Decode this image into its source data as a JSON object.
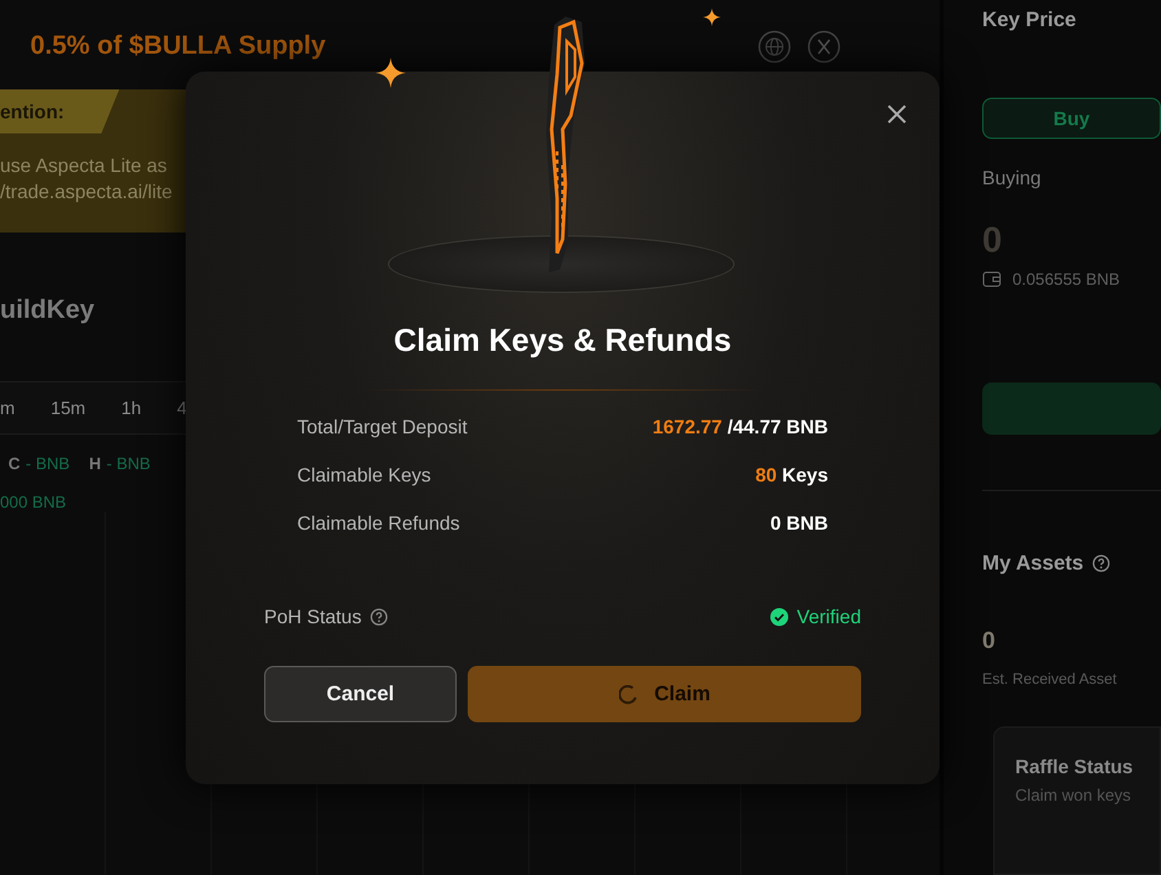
{
  "page": {
    "supply": "0.5% of $BULLA Supply",
    "attention": {
      "label": "ention:",
      "lines": [
        "use Aspecta Lite as",
        "/trade.aspecta.ai/lite"
      ]
    },
    "heading": "uildKey",
    "timeframes": [
      {
        "label": "m"
      },
      {
        "label": "15m"
      },
      {
        "label": "1h"
      },
      {
        "label": "4"
      }
    ],
    "ohlc": [
      {
        "key": "C",
        "value": "- BNB"
      },
      {
        "key": "H",
        "value": "- BNB"
      }
    ],
    "volume": "000 BNB"
  },
  "side_panel": {
    "title": "Key Price",
    "buy_button": "Buy",
    "buying_label": "Buying",
    "amount": "0",
    "balance": "0.056555 BNB",
    "assets_title": "My Assets",
    "assets_value": "0",
    "assets_caption": "Est. Received Asset",
    "raffle": {
      "title": "Raffle Status",
      "caption": "Claim won keys"
    }
  },
  "modal": {
    "title": "Claim Keys & Refunds",
    "rows": [
      {
        "label": "Total/Target Deposit",
        "highlight": "1672.77",
        "value": "/44.77 BNB"
      },
      {
        "label": "Claimable Keys",
        "highlight": "80",
        "value": "Keys"
      },
      {
        "label": "Claimable Refunds",
        "value": "0 BNB"
      }
    ],
    "poh": {
      "label": "PoH Status",
      "status": "Verified",
      "verified": true
    },
    "buttons": [
      {
        "label": "Cancel",
        "kind": "secondary",
        "loading": false
      },
      {
        "label": "Claim",
        "kind": "primary",
        "loading": true
      }
    ]
  }
}
